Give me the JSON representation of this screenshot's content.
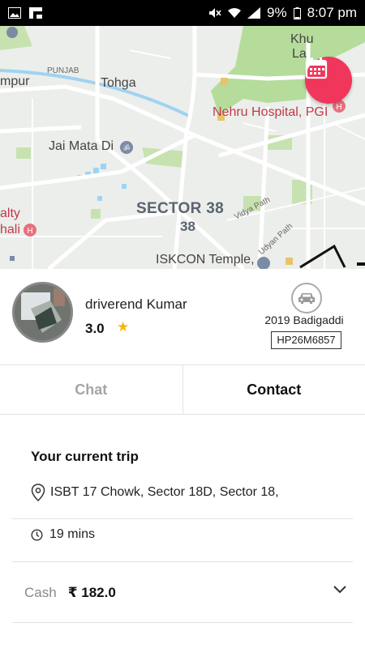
{
  "status_bar": {
    "battery": "9%",
    "time": "8:07 pm"
  },
  "map": {
    "labels": {
      "khuda": "Khu",
      "khuda2": "La",
      "tohga": "Tohga",
      "mpur": "mpur",
      "punjab": "PUNJAB",
      "hospital": "Nehru Hospital, PGI",
      "jai_mata_di": "Jai Mata Di",
      "sector": "SECTOR 38",
      "sector_num": "38",
      "vidya_path": "Vidya Path",
      "udyan_path": "Udyan Path",
      "ialty": "alty",
      "ihali": "hali",
      "iskcon": "ISKCON Temple,"
    }
  },
  "driver": {
    "name": "driverend Kumar",
    "rating": "3.0",
    "car_model": "2019 Badigaddi",
    "plate": "HP26M6857"
  },
  "actions": {
    "chat": "Chat",
    "contact": "Contact"
  },
  "trip": {
    "title": "Your current trip",
    "address": "ISBT 17 Chowk, Sector 18D, Sector 18,",
    "duration": "19 mins",
    "payment_method": "Cash",
    "amount": "₹ 182.0"
  },
  "colors": {
    "accent": "#f0365a",
    "star": "#f5b800",
    "map_green": "#b5dc9b",
    "map_bg": "#eceeeb"
  }
}
